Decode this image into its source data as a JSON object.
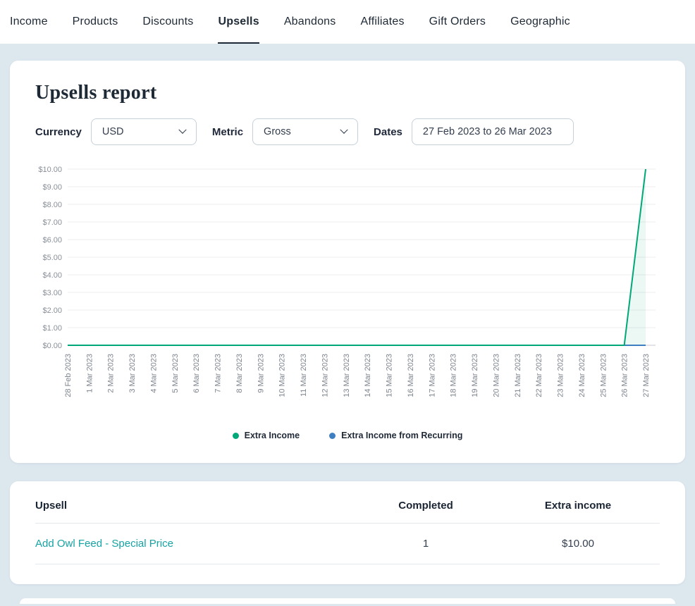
{
  "colors": {
    "link": "#16a3a3",
    "page_bg": "#dde7ee",
    "extra_income_green": "#00a878",
    "recurring_blue": "#3e7fc1"
  },
  "nav": {
    "items": [
      {
        "label": "Income",
        "active": false
      },
      {
        "label": "Products",
        "active": false
      },
      {
        "label": "Discounts",
        "active": false
      },
      {
        "label": "Upsells",
        "active": true
      },
      {
        "label": "Abandons",
        "active": false
      },
      {
        "label": "Affiliates",
        "active": false
      },
      {
        "label": "Gift Orders",
        "active": false
      },
      {
        "label": "Geographic",
        "active": false
      }
    ]
  },
  "report": {
    "title": "Upsells report",
    "filters": {
      "currency_label": "Currency",
      "currency_value": "USD",
      "metric_label": "Metric",
      "metric_value": "Gross",
      "dates_label": "Dates",
      "dates_value": "27 Feb 2023 to 26 Mar 2023"
    }
  },
  "chart_data": {
    "type": "line",
    "title": "",
    "xlabel": "",
    "ylabel": "",
    "ylim": [
      0,
      10
    ],
    "yticks": [
      0,
      1,
      2,
      3,
      4,
      5,
      6,
      7,
      8,
      9,
      10
    ],
    "ytick_prefix": "$",
    "grid": true,
    "legend_position": "bottom",
    "x": [
      "28 Feb 2023",
      "1 Mar 2023",
      "2 Mar 2023",
      "3 Mar 2023",
      "4 Mar 2023",
      "5 Mar 2023",
      "6 Mar 2023",
      "7 Mar 2023",
      "8 Mar 2023",
      "9 Mar 2023",
      "10 Mar 2023",
      "11 Mar 2023",
      "12 Mar 2023",
      "13 Mar 2023",
      "14 Mar 2023",
      "15 Mar 2023",
      "16 Mar 2023",
      "17 Mar 2023",
      "18 Mar 2023",
      "19 Mar 2023",
      "20 Mar 2023",
      "21 Mar 2023",
      "22 Mar 2023",
      "23 Mar 2023",
      "24 Mar 2023",
      "25 Mar 2023",
      "26 Mar 2023",
      "27 Mar 2023"
    ],
    "series": [
      {
        "name": "Extra Income",
        "color": "#00a878",
        "values": [
          0,
          0,
          0,
          0,
          0,
          0,
          0,
          0,
          0,
          0,
          0,
          0,
          0,
          0,
          0,
          0,
          0,
          0,
          0,
          0,
          0,
          0,
          0,
          0,
          0,
          0,
          0,
          10
        ]
      },
      {
        "name": "Extra Income from Recurring",
        "color": "#3e7fc1",
        "values": [
          0,
          0,
          0,
          0,
          0,
          0,
          0,
          0,
          0,
          0,
          0,
          0,
          0,
          0,
          0,
          0,
          0,
          0,
          0,
          0,
          0,
          0,
          0,
          0,
          0,
          0,
          0,
          0
        ]
      }
    ]
  },
  "table": {
    "headers": [
      "Upsell",
      "Completed",
      "Extra income"
    ],
    "rows": [
      {
        "upsell": "Add Owl Feed - Special Price",
        "completed": "1",
        "extra_income": "$10.00"
      }
    ]
  }
}
